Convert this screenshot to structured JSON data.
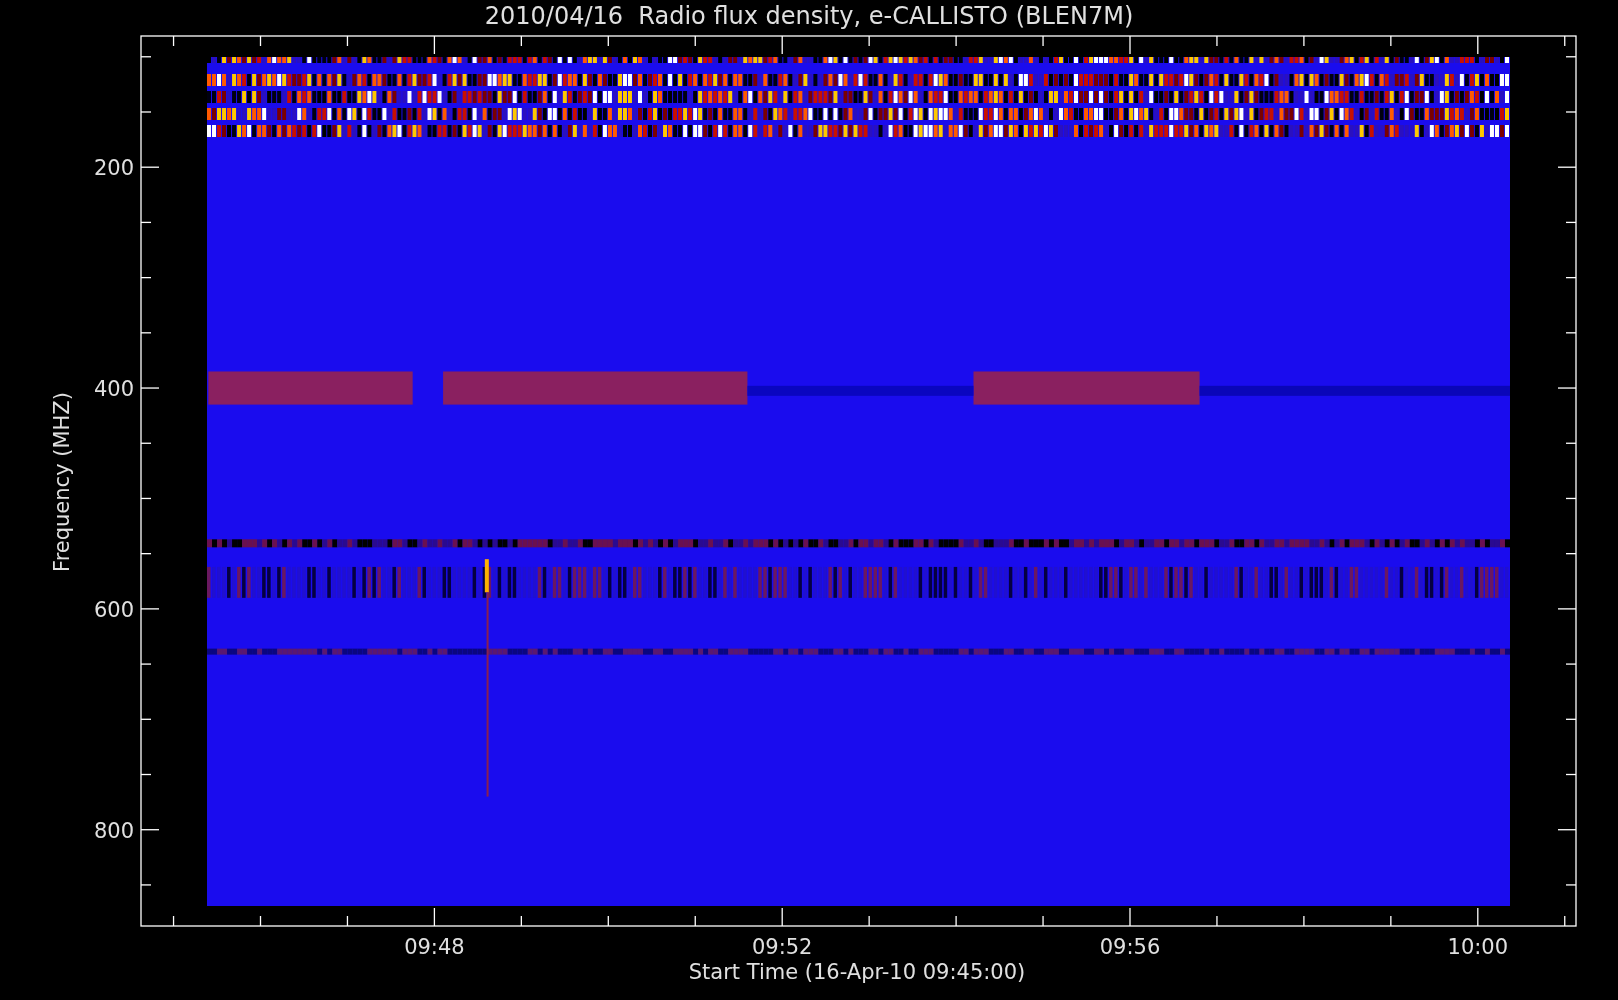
{
  "plot": {
    "title": "2010/04/16  Radio flux density, e-CALLISTO (BLEN7M)",
    "xlabel": "Start Time (16-Apr-10 09:45:00)",
    "ylabel": "Frequency (MHZ)",
    "xticks": [
      "09:48",
      "09:52",
      "09:56",
      "10:00"
    ],
    "yticks": [
      "200",
      "400",
      "600",
      "800"
    ]
  }
}
